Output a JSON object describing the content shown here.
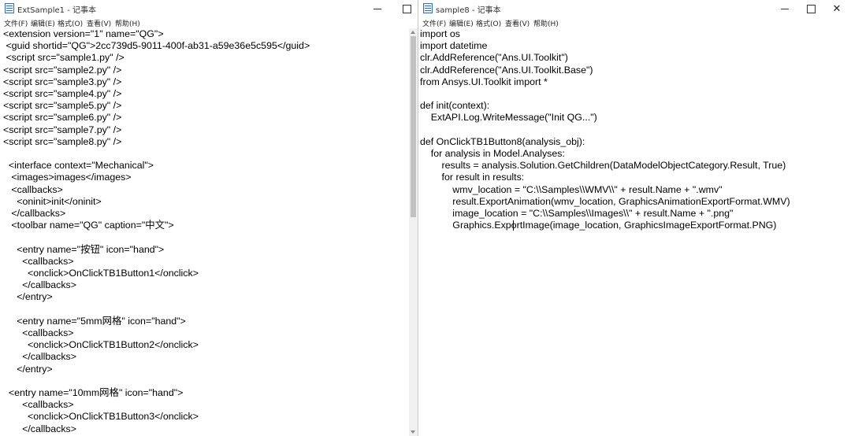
{
  "left_window": {
    "title": "ExtSample1 - 记事本",
    "menu": [
      "文件(F)",
      "编辑(E)",
      "格式(O)",
      "查看(V)",
      "帮助(H)"
    ],
    "controls": {
      "minimize": "—",
      "maximize": "☐",
      "close": "✕"
    },
    "lines": [
      "<extension version=\"1\" name=\"QG\">",
      " <guid shortid=\"QG\">2cc739d5-9011-400f-ab31-a59e36e5c595</guid>",
      " <script src=\"sample1.py\" />",
      "<script src=\"sample2.py\" />",
      "<script src=\"sample3.py\" />",
      "<script src=\"sample4.py\" />",
      "<script src=\"sample5.py\" />",
      "<script src=\"sample6.py\" />",
      "<script src=\"sample7.py\" />",
      "<script src=\"sample8.py\" />",
      "",
      "  <interface context=\"Mechanical\">",
      "   <images>images</images>",
      "   <callbacks>",
      "     <oninit>init</oninit>",
      "   </callbacks>",
      "   <toolbar name=\"QG\" caption=\"中文\">",
      "",
      "     <entry name=\"按钮\" icon=\"hand\">",
      "       <callbacks>",
      "         <onclick>OnClickTB1Button1</onclick>",
      "       </callbacks>",
      "     </entry>",
      "",
      "     <entry name=\"5mm网格\" icon=\"hand\">",
      "       <callbacks>",
      "         <onclick>OnClickTB1Button2</onclick>",
      "       </callbacks>",
      "     </entry>",
      "",
      "  <entry name=\"10mm网格\" icon=\"hand\">",
      "       <callbacks>",
      "         <onclick>OnClickTB1Button3</onclick>",
      "       </callbacks>"
    ]
  },
  "right_window": {
    "title": "sample8 - 记事本",
    "menu": [
      "文件(F)",
      "编辑(E)",
      "格式(O)",
      "查看(V)",
      "帮助(H)"
    ],
    "controls": {
      "minimize": "—",
      "maximize": "☐",
      "close": "✕"
    },
    "lines": [
      "import os",
      "import datetime",
      "clr.AddReference(\"Ans.UI.Toolkit\")",
      "clr.AddReference(\"Ans.UI.Toolkit.Base\")",
      "from Ansys.UI.Toolkit import *",
      "",
      "def init(context):",
      "    ExtAPI.Log.WriteMessage(\"Init QG...\")",
      "",
      "def OnClickTB1Button8(analysis_obj):",
      "    for analysis in Model.Analyses:",
      "        results = analysis.Solution.GetChildren(DataModelObjectCategory.Result, True)",
      "        for result in results:",
      "            wmv_location = \"C:\\\\Samples\\\\WMV\\\\\" + result.Name + \".wmv\"",
      "            result.ExportAnimation(wmv_location, GraphicsAnimationExportFormat.WMV)",
      "            image_location = \"C:\\\\Samples\\\\Images\\\\\" + result.Name + \".png\"",
      "            Graphics.ExportImage(image_location, GraphicsImageExportFormat.PNG)"
    ]
  }
}
